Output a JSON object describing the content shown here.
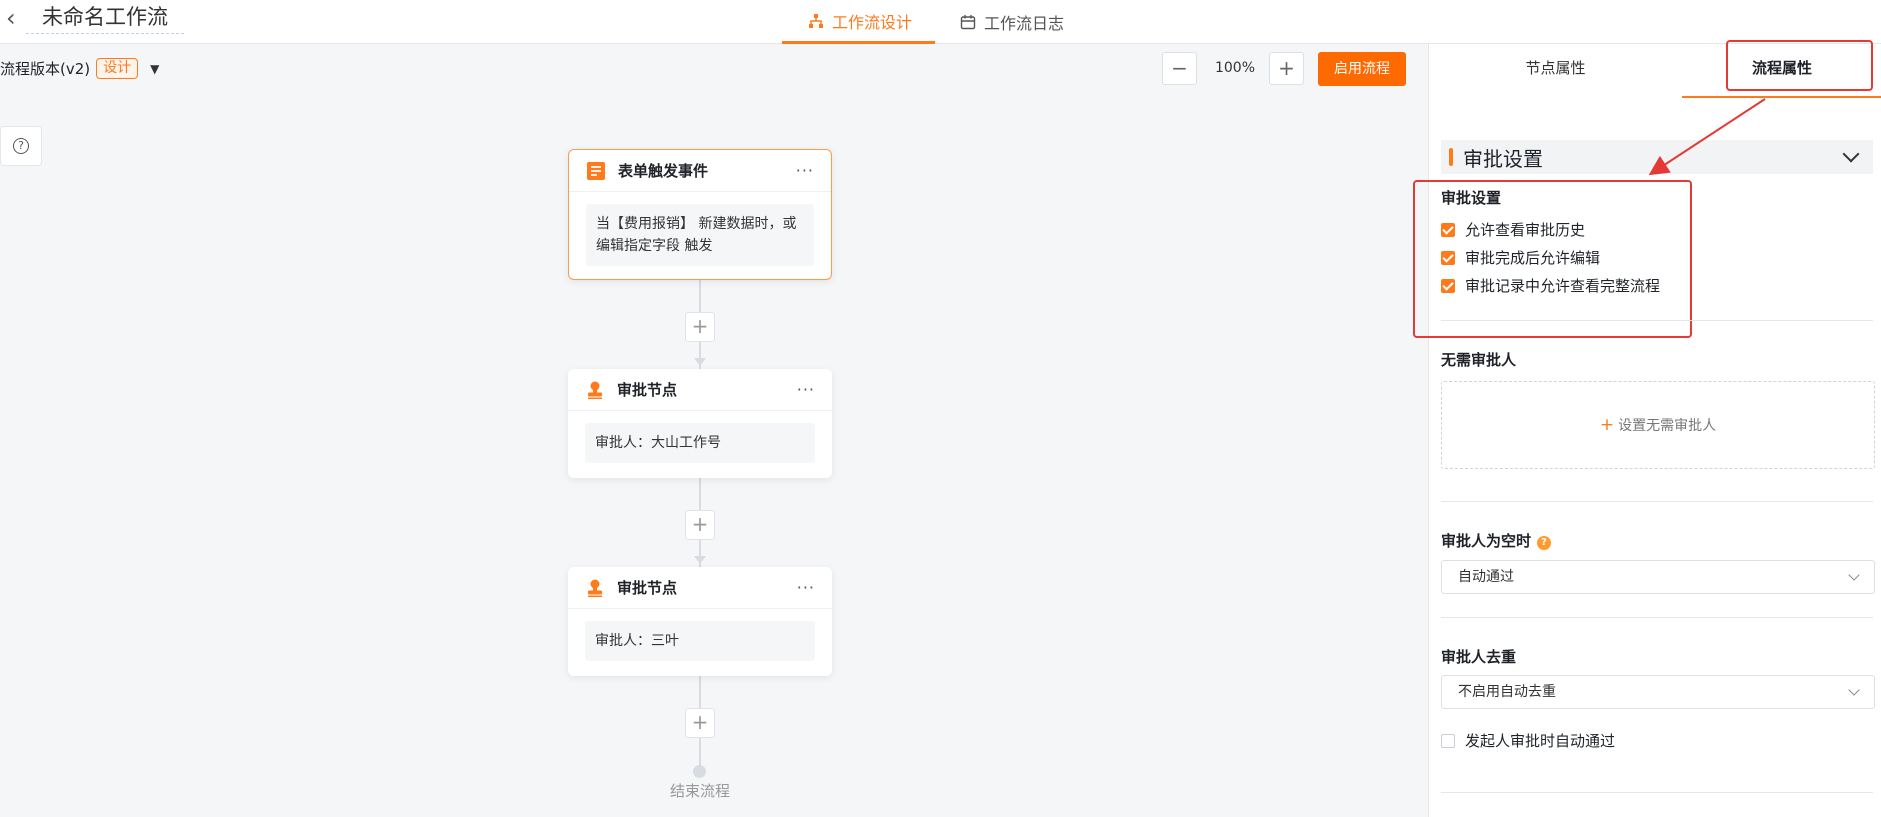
{
  "header": {
    "title": "未命名工作流",
    "tabs": [
      {
        "label": "工作流设计",
        "active": true,
        "icon": "flow-diagram-icon"
      },
      {
        "label": "工作流日志",
        "active": false,
        "icon": "calendar-icon"
      }
    ]
  },
  "toolbar": {
    "version_label": "流程版本(v2)",
    "mode_badge": "设计",
    "zoom_level": "100%",
    "zoom_out": "−",
    "zoom_in": "+",
    "enable_label": "启用流程"
  },
  "flow": {
    "nodes": [
      {
        "title": "表单触发事件",
        "body": "当【费用报销】 新建数据时，或编辑指定字段 触发",
        "icon": "form-icon"
      },
      {
        "title": "审批节点",
        "body": "审批人：大山工作号",
        "icon": "stamp-icon"
      },
      {
        "title": "审批节点",
        "body": "审批人：三叶",
        "icon": "stamp-icon"
      }
    ],
    "add_label": "+",
    "more_label": "···",
    "end_label": "结束流程"
  },
  "panel": {
    "tabs": [
      "节点属性",
      "流程属性"
    ],
    "active_tab": "流程属性",
    "section_title": "审批设置",
    "approval_settings": {
      "label": "审批设置",
      "options": [
        {
          "label": "允许查看审批历史",
          "checked": true
        },
        {
          "label": "审批完成后允许编辑",
          "checked": true
        },
        {
          "label": "审批记录中允许查看完整流程",
          "checked": true
        }
      ]
    },
    "no_approver": {
      "label": "无需审批人",
      "add_label": "设置无需审批人"
    },
    "empty_approver": {
      "label": "审批人为空时",
      "help": "?",
      "value": "自动通过"
    },
    "dedup": {
      "label": "审批人去重",
      "value": "不启用自动去重"
    },
    "auto_pass": {
      "label": "发起人审批时自动通过",
      "checked": false
    }
  },
  "colors": {
    "accent": "#ff7a1a",
    "button": "#ff6a00",
    "annotation": "#e53935"
  }
}
